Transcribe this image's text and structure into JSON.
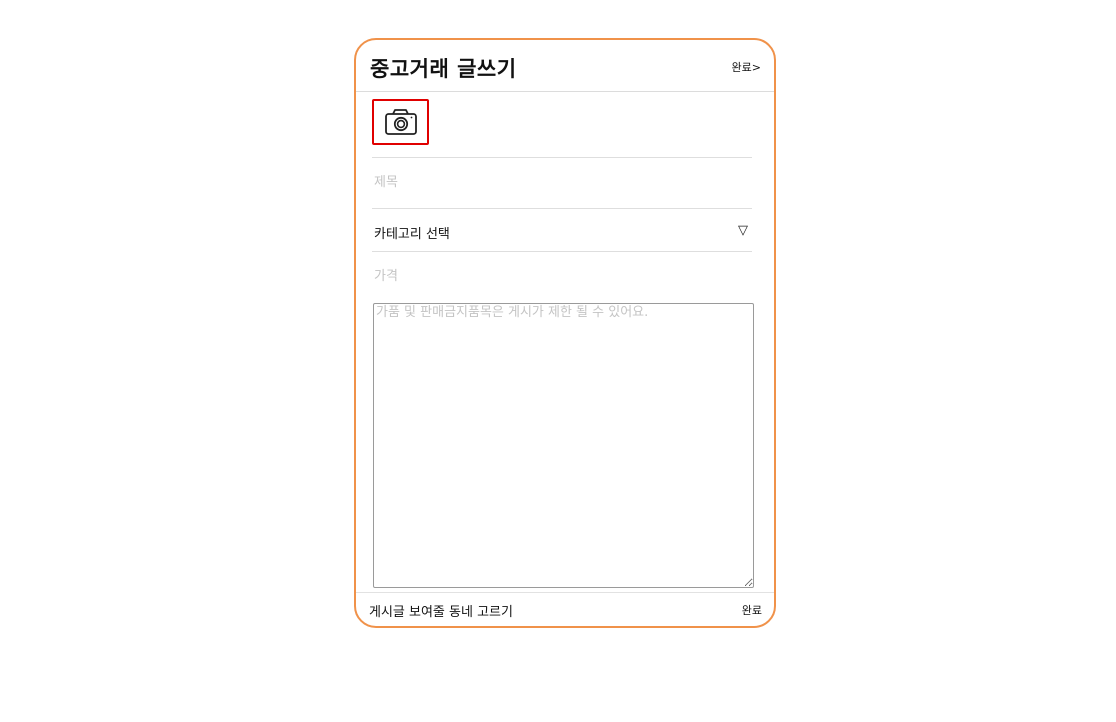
{
  "header": {
    "title": "중고거래 글쓰기",
    "done_label": "완료>"
  },
  "photo": {
    "icon": "camera-icon"
  },
  "form": {
    "title_placeholder": "제목",
    "title_value": "",
    "category_label": "카테고리 선택",
    "category_arrow": "▽",
    "price_placeholder": "가격",
    "price_value": "",
    "description_placeholder": "가품 및 판매금지품목은 게시가 제한 될 수 있어요.",
    "description_value": ""
  },
  "footer": {
    "neighborhood_label": "게시글 보여줄 동네 고르기",
    "done_label": "완료"
  },
  "colors": {
    "frame_border": "#f0924a",
    "selection_highlight": "#e00000",
    "placeholder": "#c4c4c4"
  }
}
